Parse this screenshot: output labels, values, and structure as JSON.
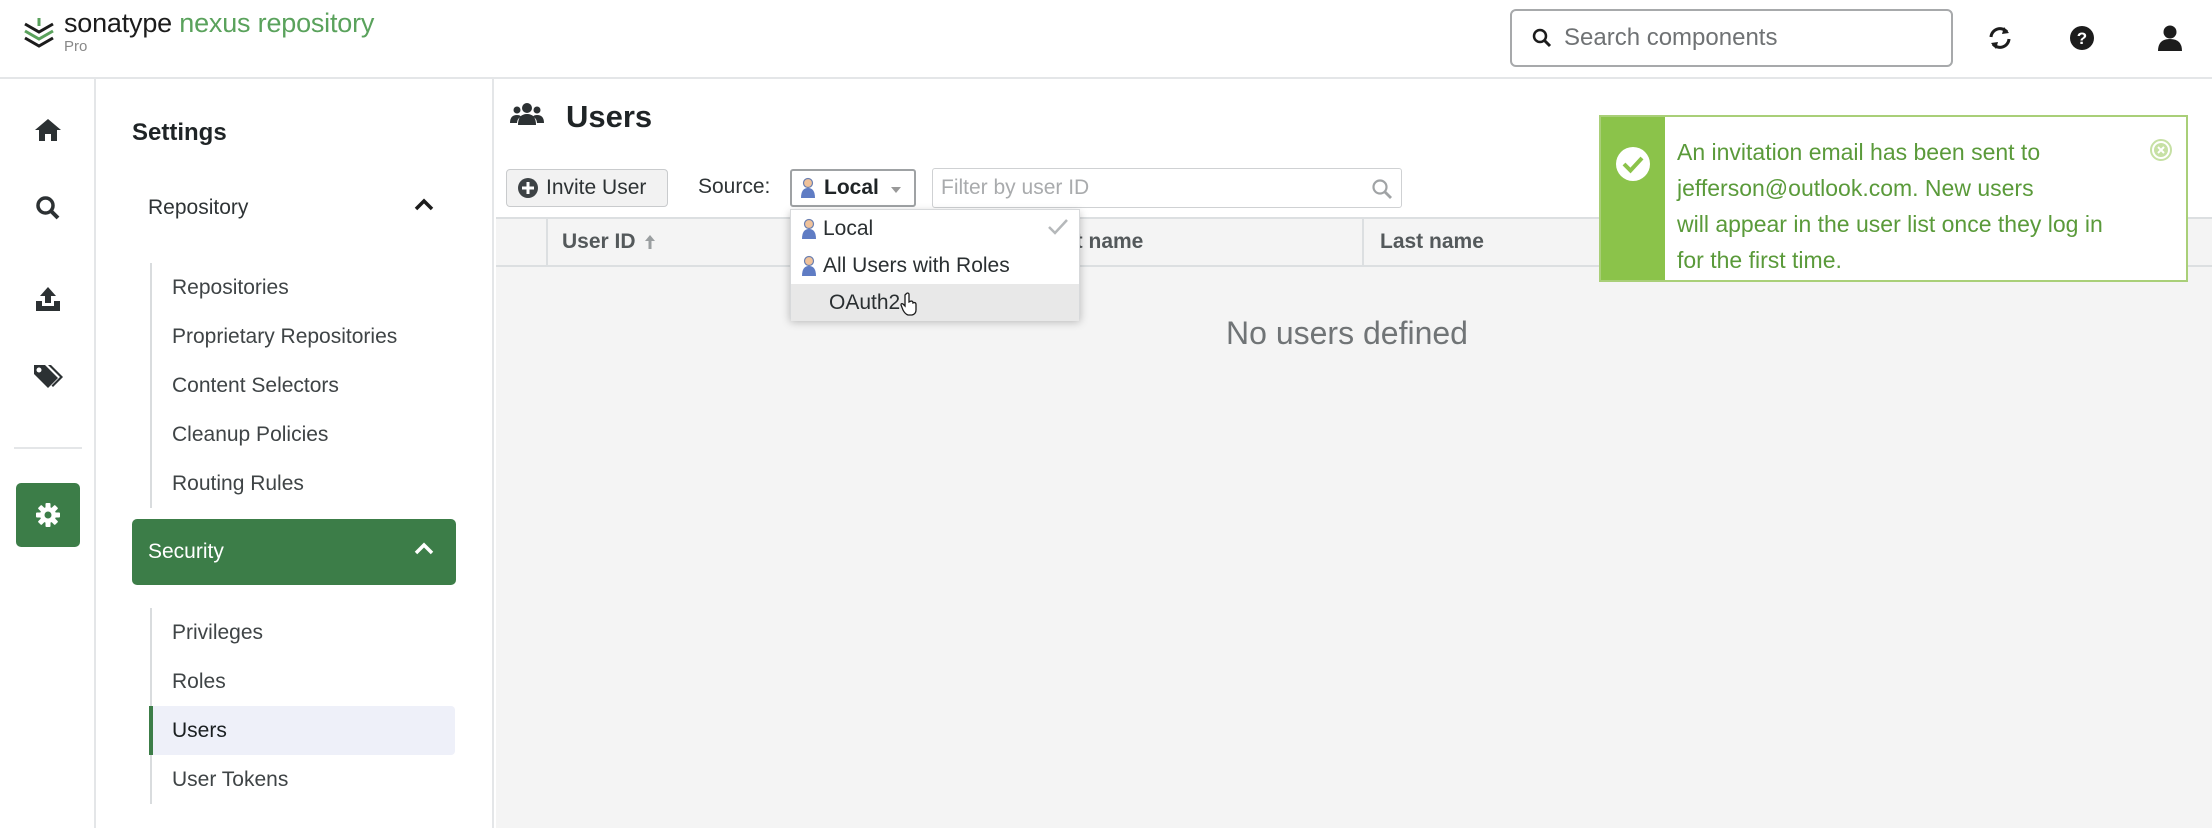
{
  "app": {
    "brand": "sonatype",
    "product": "nexus repository",
    "edition": "Pro"
  },
  "topbar": {
    "search_placeholder": "Search components",
    "icons": [
      "refresh-icon",
      "help-icon",
      "user-icon"
    ]
  },
  "leftnav": {
    "items": [
      "home-icon",
      "search-icon",
      "upload-icon",
      "tags-icon",
      "settings-icon"
    ],
    "active": "settings-icon"
  },
  "settings": {
    "title": "Settings",
    "repository": {
      "label": "Repository",
      "items": [
        "Repositories",
        "Proprietary Repositories",
        "Content Selectors",
        "Cleanup Policies",
        "Routing Rules"
      ]
    },
    "security": {
      "label": "Security",
      "items": [
        "Privileges",
        "Roles",
        "Users",
        "User Tokens"
      ],
      "active": "Users"
    }
  },
  "main": {
    "title": "Users",
    "invite_label": "Invite User",
    "source_label": "Source:",
    "source_value": "Local",
    "filter_placeholder": "Filter by user ID",
    "columns": [
      "User ID",
      "First name",
      "Last name"
    ],
    "columns_visible": [
      "User ID",
      "st name",
      "Last name"
    ],
    "empty_text": "No users defined"
  },
  "source_dropdown": {
    "options": [
      "Local",
      "All Users with Roles",
      "OAuth2"
    ],
    "selected": "Local",
    "hovered": "OAuth2"
  },
  "toast": {
    "message_lines": [
      "An invitation email has been sent to",
      "jefferson@outlook.com. New users",
      "will appear in the user list once they log in",
      "for the first time."
    ],
    "color": "#8bc34a"
  },
  "colors": {
    "accent": "#3c7d48",
    "brand_green": "#5aa25c",
    "success": "#8bc34a"
  }
}
